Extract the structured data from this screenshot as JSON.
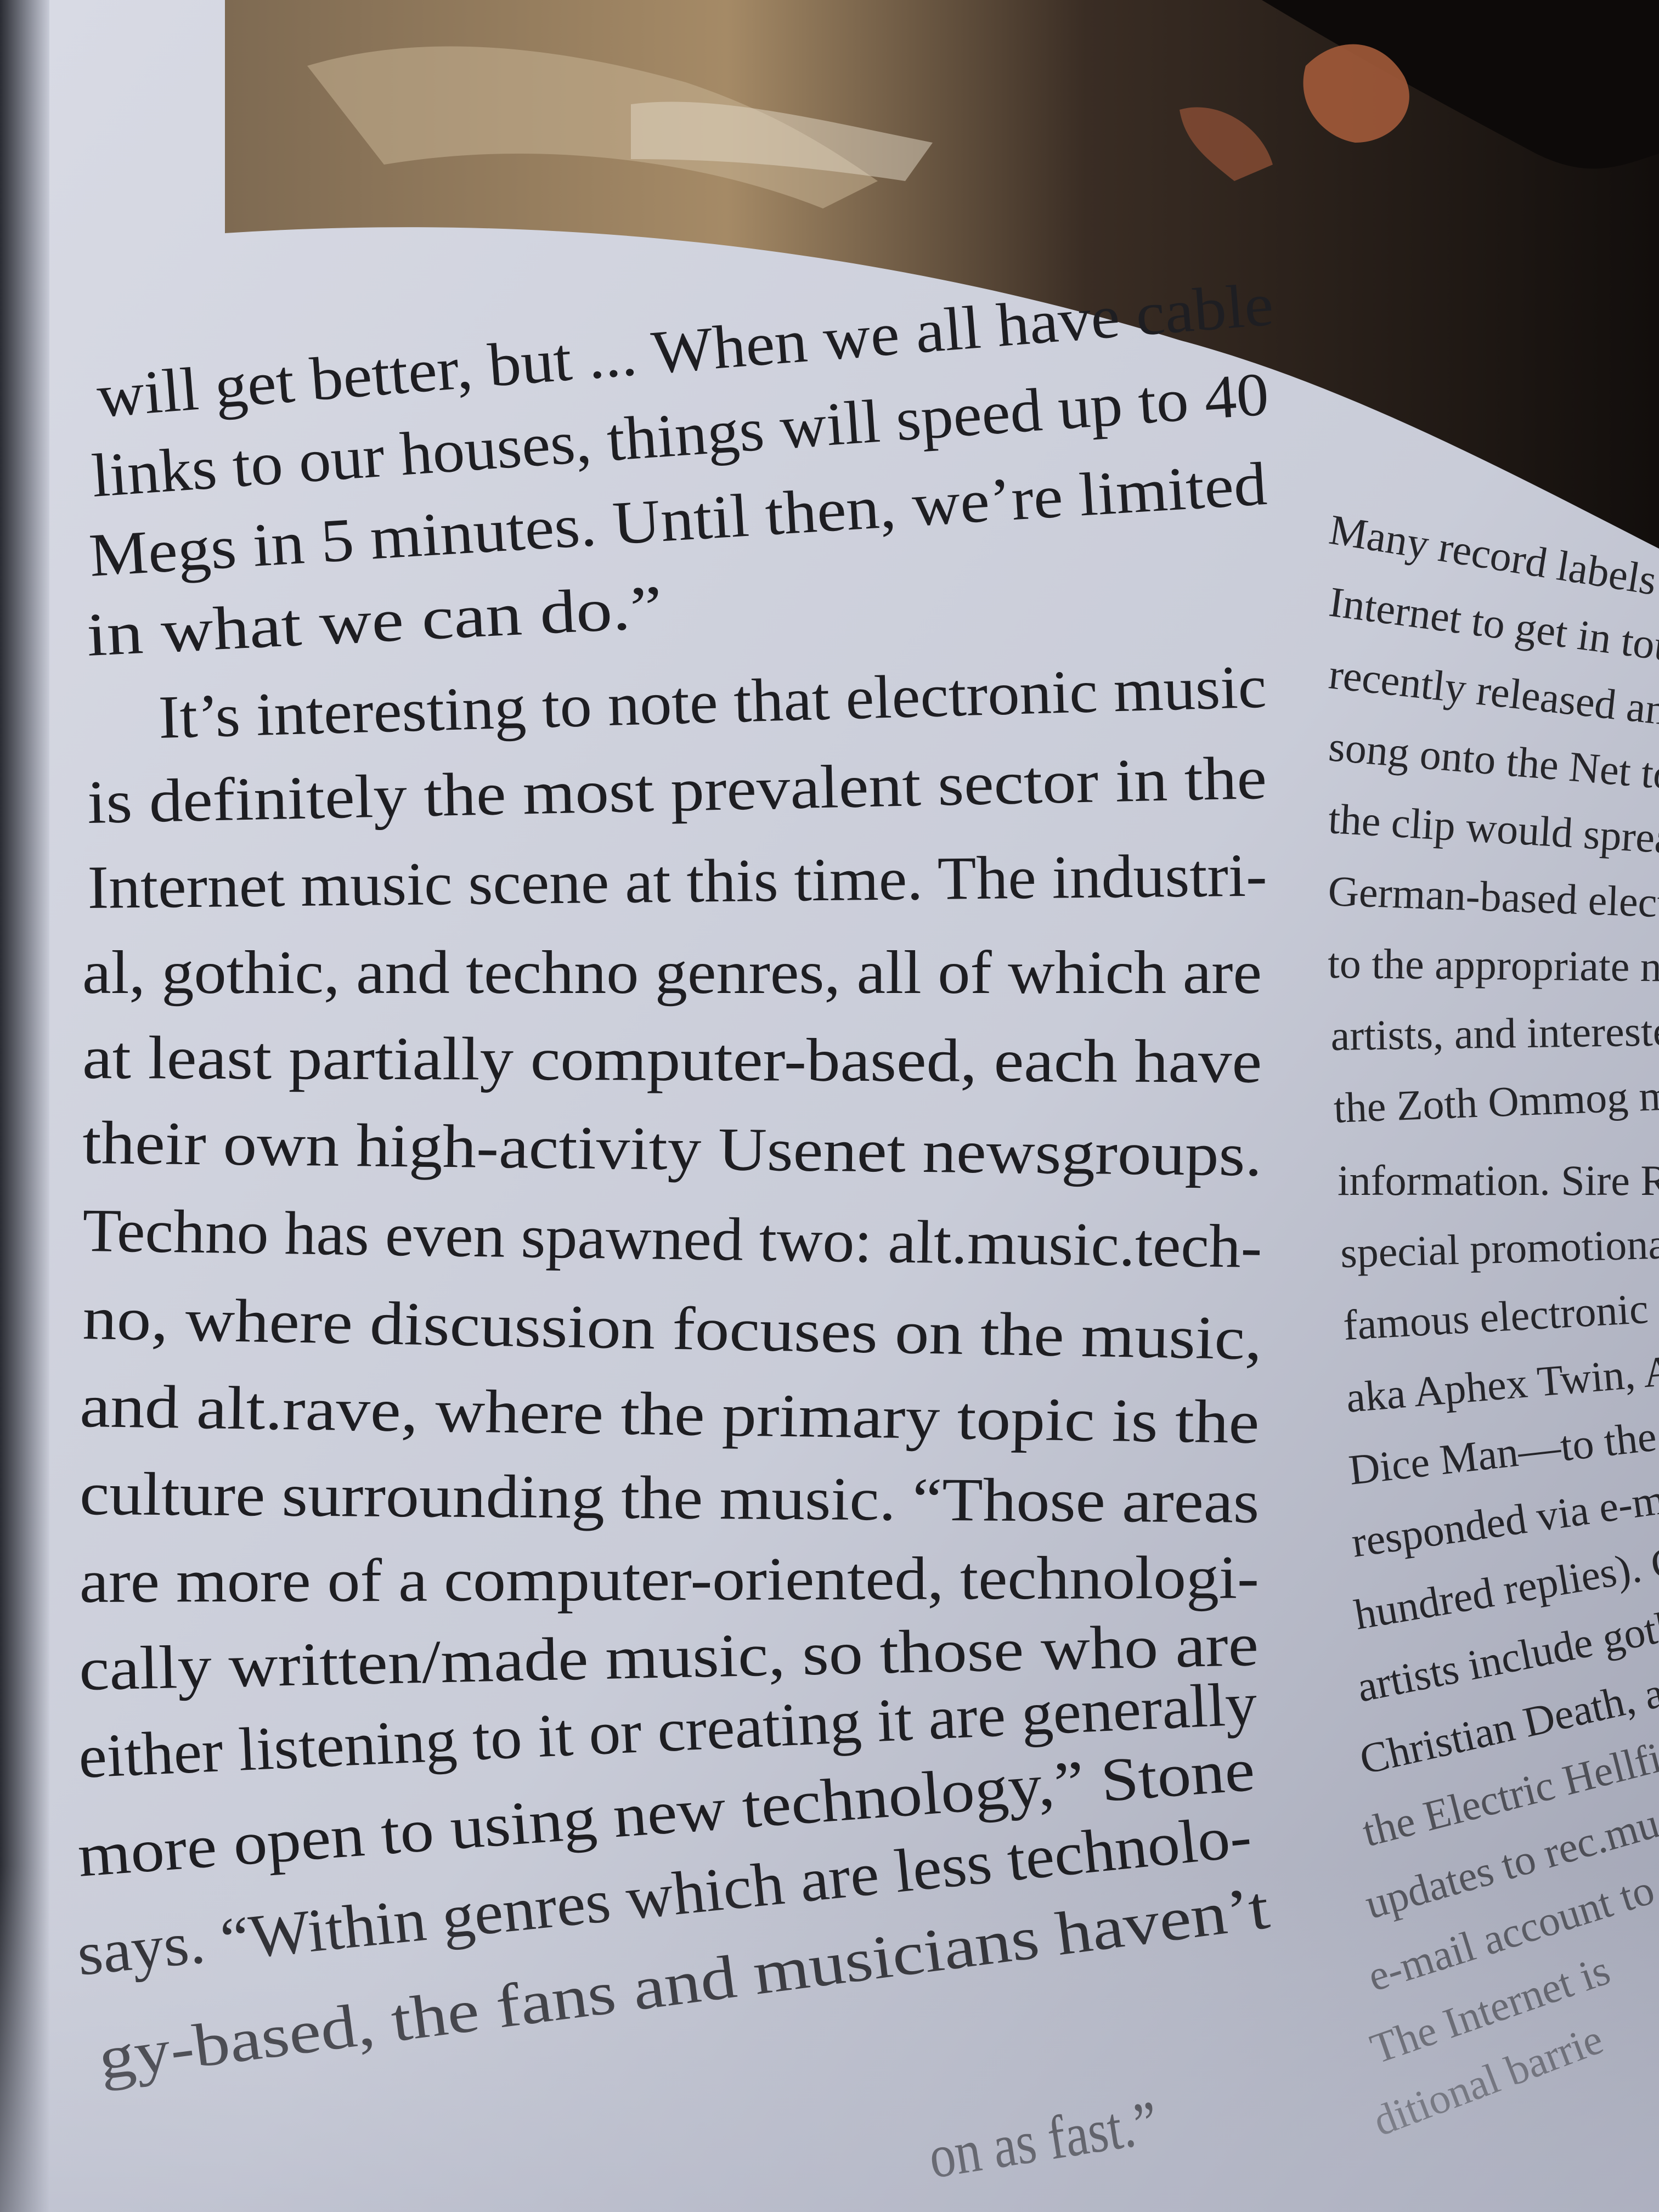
{
  "colors": {
    "paper": "#cfd1dc",
    "paper_shadow": "#a9acba",
    "ink": "#1e1e22",
    "photo_dark": "#1a1512",
    "photo_warm": "#a58a66"
  },
  "photo": {
    "description_icon": "photo-of-desk-and-person"
  },
  "left_column": {
    "lines": [
      "will get better, but ... When we all have cable",
      "links to our houses, things will speed up to 40",
      "Megs in 5 minutes. Until then, we’re limited",
      "in what we can do.”",
      "It’s interesting to note that electronic music",
      "is definitely the most prevalent sector in the",
      "Internet music scene at this time. The industri-",
      "al, gothic, and techno genres, all of which are",
      "at least partially computer-based, each have",
      "their own high-activity Usenet newsgroups.",
      "Techno has even spawned two: alt.music.tech-",
      "no, where discussion focuses on the music,",
      "and alt.rave, where the primary topic is the",
      "culture surrounding the music. “Those areas",
      "are more of a computer-oriented, technologi-",
      "cally written/made music, so those who are",
      "either listening to it or creating it are generally",
      "more open to using new technology,” Stone",
      "says. “Within genres which are less technolo-",
      "gy-based, the fans and musicians haven’t",
      "on as fast.”"
    ]
  },
  "right_column": {
    "lines": [
      "Many record labels are also",
      "Internet to get in touch with th",
      "recently released an unrelease",
      "song onto the Net to determin",
      "the clip would spread. Zoth",
      "German-based electronic lab",
      "to the appropriate newsgro",
      "artists, and interested parti",
      "the Zoth Ommog mailing",
      "information. Sire Record",
      "special promotional CD",
      "famous electronic music",
      "aka Aphex Twin, AFX,",
      "Dice Man—to the first",
      "responded via e-mail",
      "hundred replies). Cle",
      "artists include gothic",
      "Christian Death, and",
      "the Electric Hellfir",
      "updates to rec.mus",
      "e-mail account to",
      "The Internet is",
      "ditional barrie"
    ]
  }
}
